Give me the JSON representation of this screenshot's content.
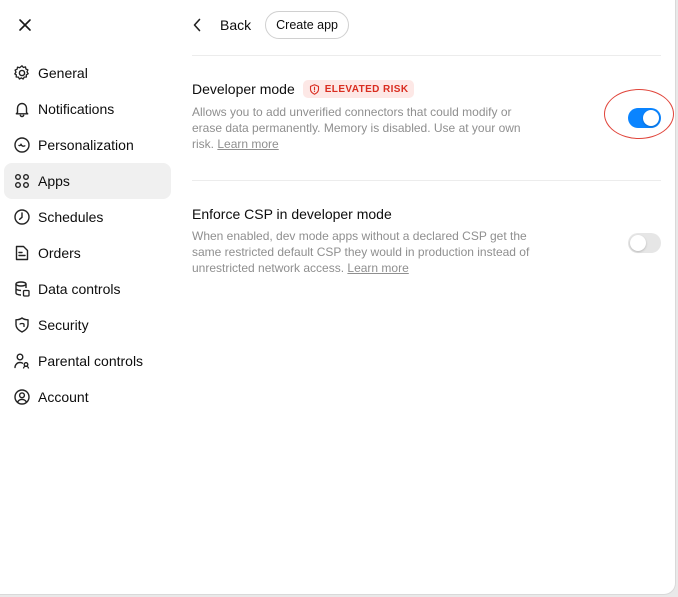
{
  "header": {
    "back_label": "Back",
    "create_app_label": "Create app"
  },
  "sidebar": {
    "items": [
      {
        "label": "General",
        "icon": "gear-icon"
      },
      {
        "label": "Notifications",
        "icon": "bell-icon"
      },
      {
        "label": "Personalization",
        "icon": "personalization-icon"
      },
      {
        "label": "Apps",
        "icon": "apps-grid-icon",
        "active": true
      },
      {
        "label": "Schedules",
        "icon": "clock-icon"
      },
      {
        "label": "Orders",
        "icon": "receipt-icon"
      },
      {
        "label": "Data controls",
        "icon": "database-icon"
      },
      {
        "label": "Security",
        "icon": "shield-icon"
      },
      {
        "label": "Parental controls",
        "icon": "parental-icon"
      },
      {
        "label": "Account",
        "icon": "account-icon"
      }
    ]
  },
  "settings": {
    "developer_mode": {
      "title": "Developer mode",
      "badge": "ELEVATED RISK",
      "description": "Allows you to add unverified connectors that could modify or erase data permanently. Memory is disabled. Use at your own risk.",
      "link": "Learn more",
      "enabled": true
    },
    "enforce_csp": {
      "title": "Enforce CSP in developer mode",
      "description": "When enabled, dev mode apps without a declared CSP get the same restricted default CSP they would in production instead of unrestricted network access.",
      "link": "Learn more",
      "enabled": false
    }
  },
  "colors": {
    "accent": "#0a84ff",
    "risk": "#d92d20",
    "risk_bg": "#fde8e6",
    "annotation": "#e0443a"
  }
}
